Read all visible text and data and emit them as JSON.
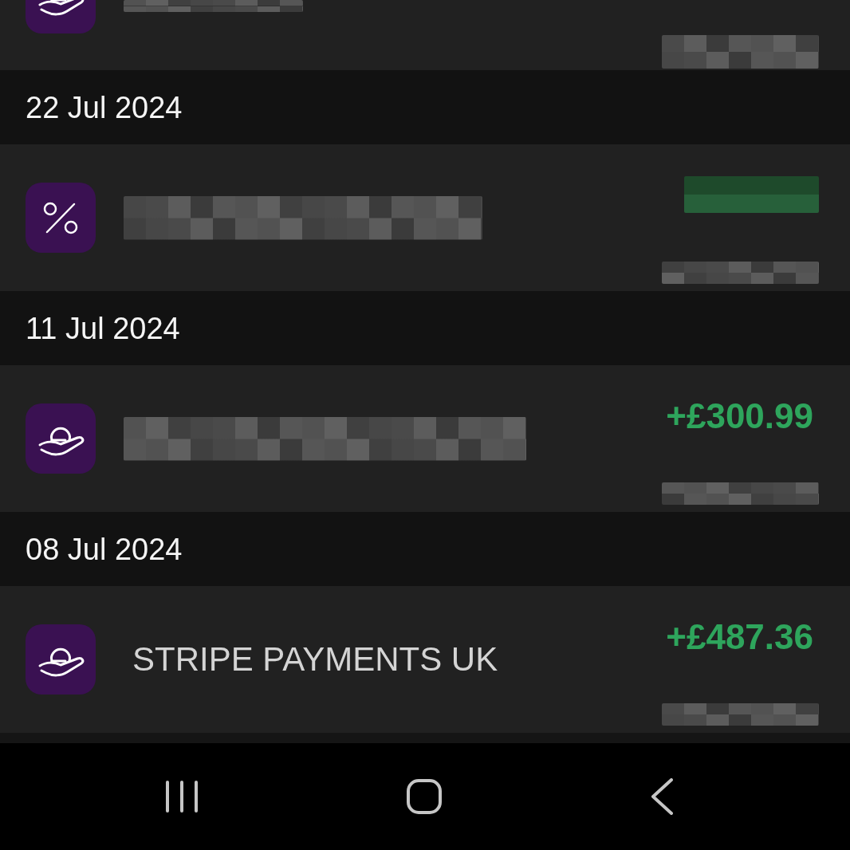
{
  "partial_transaction": {
    "kind": "payment",
    "name_pixelated": true,
    "detail_pixelated": true
  },
  "days": [
    {
      "date": "22 Jul 2024",
      "transactions": [
        {
          "kind": "interest",
          "name_pixelated": true,
          "amount_pixelated": true,
          "detail_pixelated": true
        }
      ]
    },
    {
      "date": "11 Jul 2024",
      "transactions": [
        {
          "kind": "payment",
          "name_pixelated": true,
          "amount": "+£300.99",
          "detail_pixelated": true
        }
      ]
    },
    {
      "date": "08 Jul 2024",
      "transactions": [
        {
          "kind": "payment",
          "name": "STRIPE PAYMENTS UK",
          "amount": "+£487.36",
          "detail_pixelated": true
        }
      ]
    }
  ]
}
